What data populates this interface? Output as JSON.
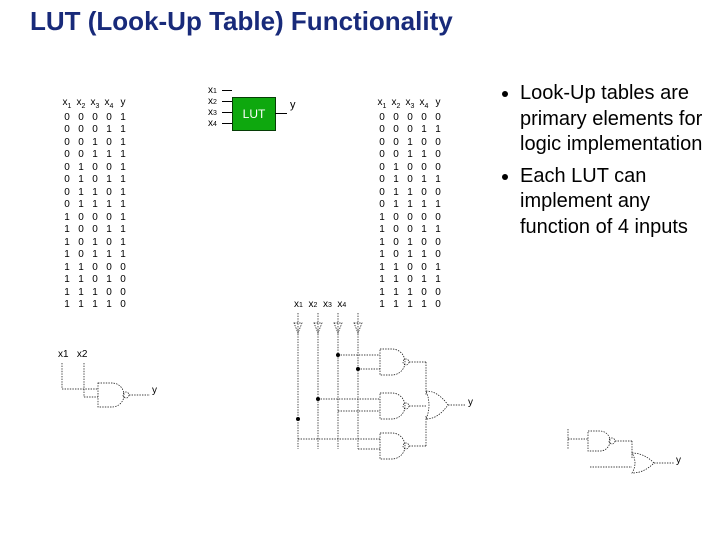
{
  "title": "LUT (Look-Up Table) Functionality",
  "bullets": [
    "Look-Up tables are primary elements for logic implementation",
    "Each LUT can implement any function of 4 inputs"
  ],
  "lut_block": {
    "inputs": [
      "x1",
      "x2",
      "x3",
      "x4"
    ],
    "label": "LUT",
    "output": "y"
  },
  "truth_tables": {
    "headers": [
      "x1",
      "x2",
      "x3",
      "x4",
      "y"
    ],
    "left_rows": [
      [
        0,
        0,
        0,
        0,
        1
      ],
      [
        0,
        0,
        0,
        1,
        1
      ],
      [
        0,
        0,
        1,
        0,
        1
      ],
      [
        0,
        0,
        1,
        1,
        1
      ],
      [
        0,
        1,
        0,
        0,
        1
      ],
      [
        0,
        1,
        0,
        1,
        1
      ],
      [
        0,
        1,
        1,
        0,
        1
      ],
      [
        0,
        1,
        1,
        1,
        1
      ],
      [
        1,
        0,
        0,
        0,
        1
      ],
      [
        1,
        0,
        0,
        1,
        1
      ],
      [
        1,
        0,
        1,
        0,
        1
      ],
      [
        1,
        0,
        1,
        1,
        1
      ],
      [
        1,
        1,
        0,
        0,
        0
      ],
      [
        1,
        1,
        0,
        1,
        0
      ],
      [
        1,
        1,
        1,
        0,
        0
      ],
      [
        1,
        1,
        1,
        1,
        0
      ]
    ],
    "right_rows": [
      [
        0,
        0,
        0,
        0,
        0
      ],
      [
        0,
        0,
        0,
        1,
        1
      ],
      [
        0,
        0,
        1,
        0,
        0
      ],
      [
        0,
        0,
        1,
        1,
        0
      ],
      [
        0,
        1,
        0,
        0,
        0
      ],
      [
        0,
        1,
        0,
        1,
        1
      ],
      [
        0,
        1,
        1,
        0,
        0
      ],
      [
        0,
        1,
        1,
        1,
        1
      ],
      [
        1,
        0,
        0,
        0,
        0
      ],
      [
        1,
        0,
        0,
        1,
        1
      ],
      [
        1,
        0,
        1,
        0,
        0
      ],
      [
        1,
        0,
        1,
        1,
        0
      ],
      [
        1,
        1,
        0,
        0,
        1
      ],
      [
        1,
        1,
        0,
        1,
        1
      ],
      [
        1,
        1,
        1,
        0,
        0
      ],
      [
        1,
        1,
        1,
        1,
        0
      ]
    ]
  },
  "circuits": {
    "left": {
      "inputs": [
        "x1",
        "x2"
      ],
      "output": "y"
    },
    "mid": {
      "inputs": [
        "x1",
        "x2",
        "x3",
        "x4"
      ],
      "output": "y"
    },
    "right": {
      "inputs": [],
      "output": "y"
    }
  }
}
